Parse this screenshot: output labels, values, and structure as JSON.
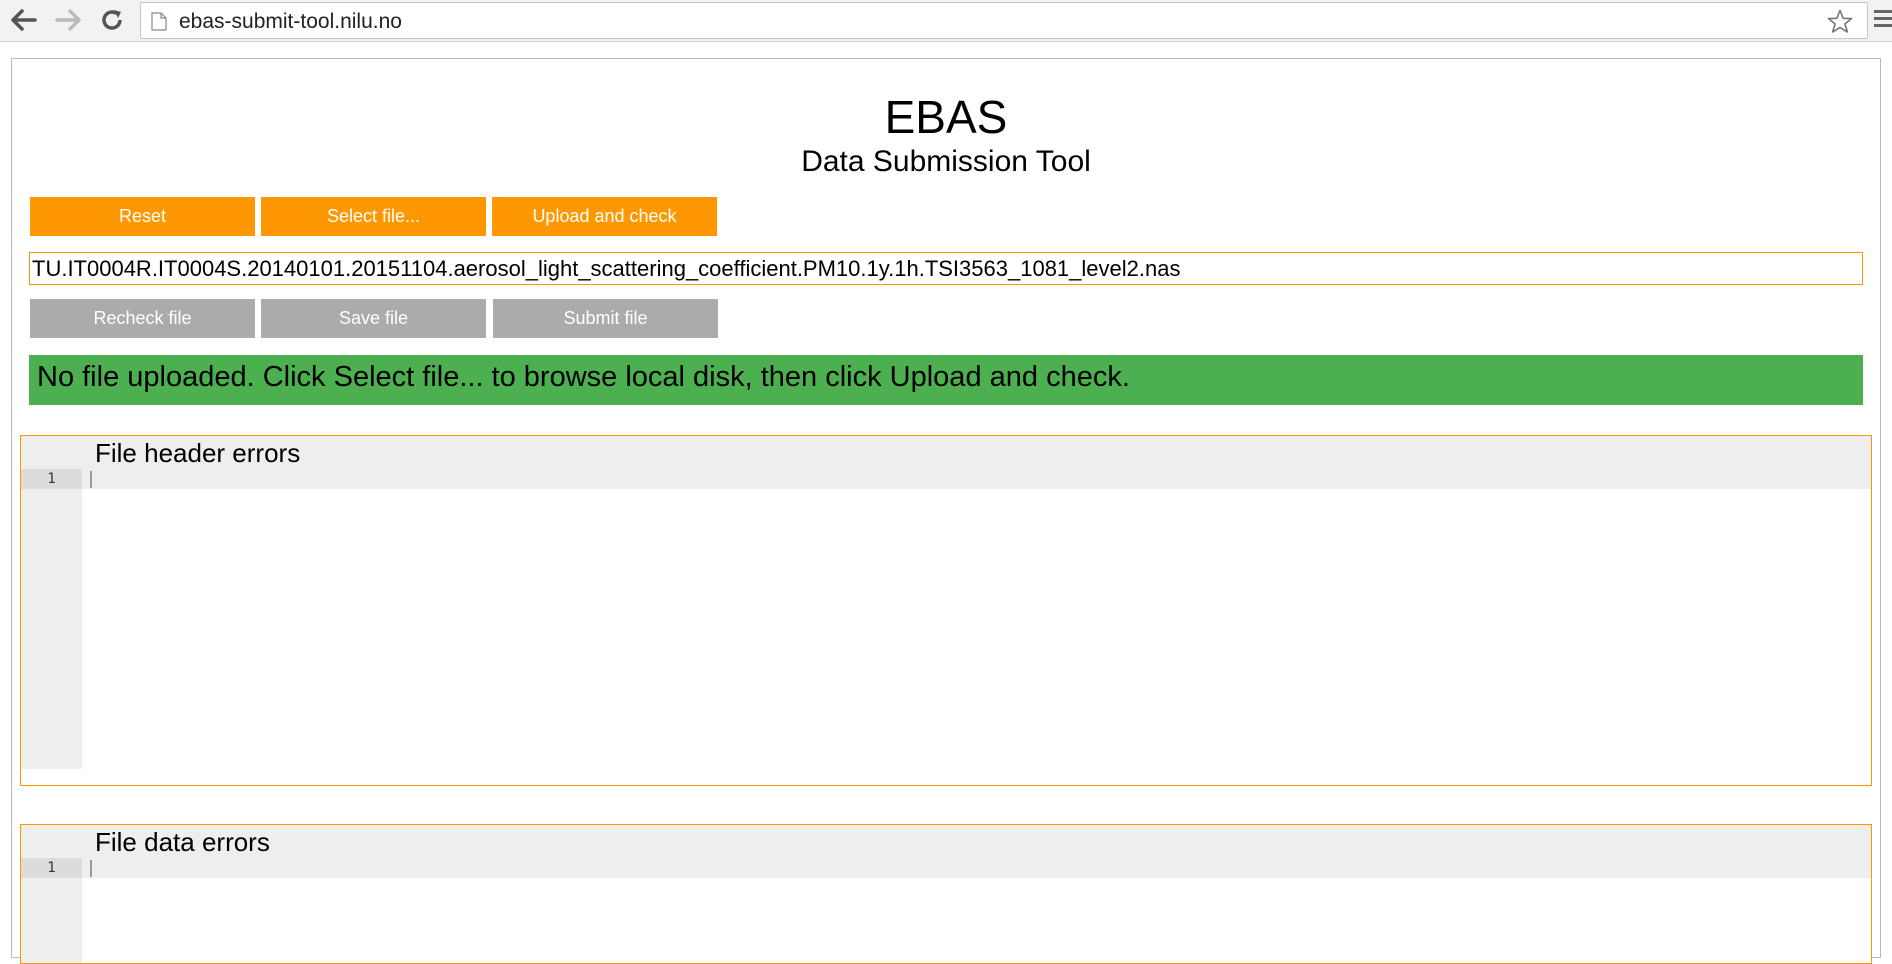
{
  "browser": {
    "url": "ebas-submit-tool.nilu.no",
    "icons": {
      "back": "back-arrow-icon",
      "forward": "forward-arrow-icon",
      "reload": "reload-icon",
      "page": "page-icon",
      "bookmark": "star-icon",
      "menu": "menu-icon"
    }
  },
  "header": {
    "title": "EBAS",
    "subtitle": "Data Submission Tool"
  },
  "toolbar": {
    "reset_label": "Reset",
    "select_label": "Select file...",
    "upload_label": "Upload and check"
  },
  "file": {
    "name": "TU.IT0004R.IT0004S.20140101.20151104.aerosol_light_scattering_coefficient.PM10.1y.1h.TSI3563_1081_level2.nas"
  },
  "actions": {
    "recheck_label": "Recheck file",
    "save_label": "Save file",
    "submit_label": "Submit file"
  },
  "status": {
    "message": "No file uploaded. Click Select file... to browse local disk, then click Upload and check."
  },
  "panels": [
    {
      "title": "File header errors",
      "line_number": "1"
    },
    {
      "title": "File data errors",
      "line_number": "1"
    }
  ],
  "colors": {
    "accent": "#ff9800",
    "disabled": "#ababab",
    "status_ok": "#4caf50"
  }
}
